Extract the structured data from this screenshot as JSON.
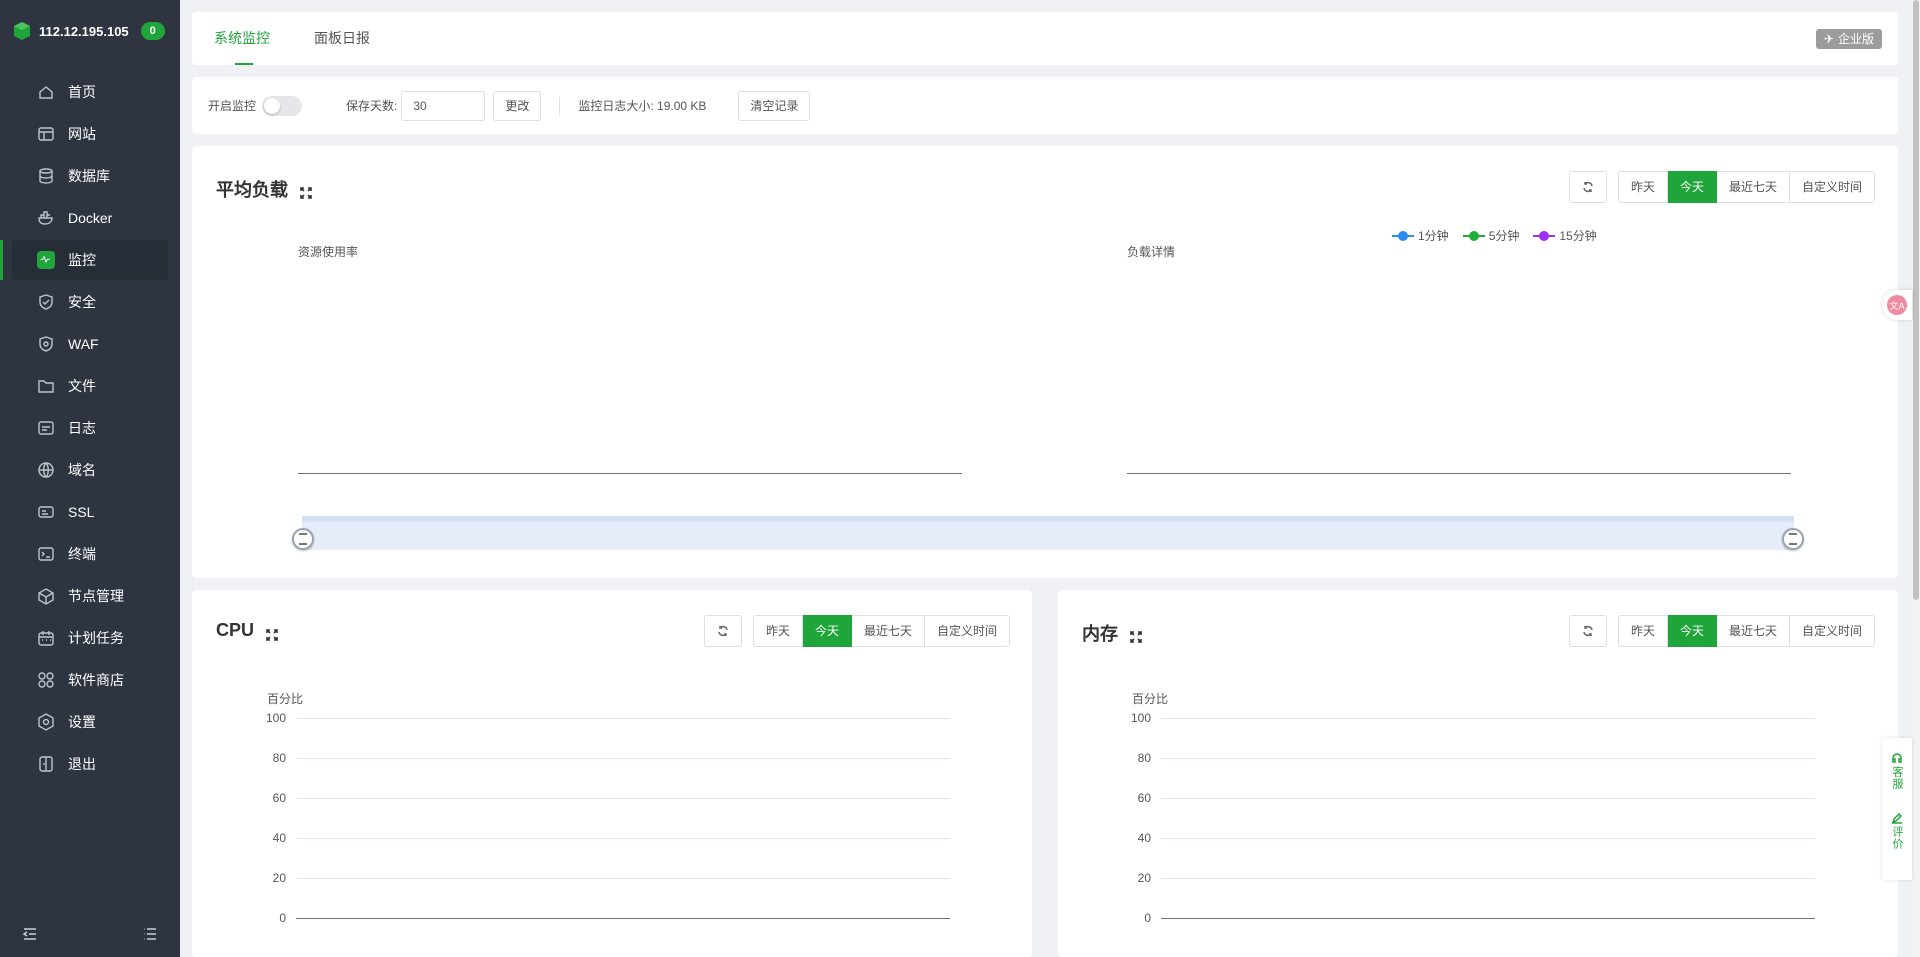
{
  "server": {
    "ip": "112.12.195.105",
    "badge": "0"
  },
  "sidebar": {
    "items": [
      {
        "label": "首页",
        "icon": "home-icon"
      },
      {
        "label": "网站",
        "icon": "website-icon"
      },
      {
        "label": "数据库",
        "icon": "database-icon"
      },
      {
        "label": "Docker",
        "icon": "docker-icon"
      },
      {
        "label": "监控",
        "icon": "monitor-icon",
        "active": true
      },
      {
        "label": "安全",
        "icon": "shield-icon"
      },
      {
        "label": "WAF",
        "icon": "waf-icon"
      },
      {
        "label": "文件",
        "icon": "folder-icon"
      },
      {
        "label": "日志",
        "icon": "log-icon"
      },
      {
        "label": "域名",
        "icon": "globe-icon"
      },
      {
        "label": "SSL",
        "icon": "ssl-icon"
      },
      {
        "label": "终端",
        "icon": "terminal-icon"
      },
      {
        "label": "节点管理",
        "icon": "node-icon"
      },
      {
        "label": "计划任务",
        "icon": "calendar-icon"
      },
      {
        "label": "软件商店",
        "icon": "apps-icon"
      },
      {
        "label": "设置",
        "icon": "settings-icon"
      },
      {
        "label": "退出",
        "icon": "logout-icon"
      }
    ]
  },
  "tabs": {
    "system_monitor": "系统监控",
    "panel_daily": "面板日报",
    "enterprise": "企业版"
  },
  "controls": {
    "enable_label": "开启监控",
    "enabled": false,
    "days_label": "保存天数:",
    "days_value": "30",
    "change_button": "更改",
    "log_size_label": "监控日志大小: 19.00 KB",
    "clear_button": "清空记录"
  },
  "ranges": {
    "yesterday": "昨天",
    "today": "今天",
    "last7": "最近七天",
    "custom": "自定义时间"
  },
  "load_panel": {
    "title": "平均负载",
    "left_chart_title": "资源使用率",
    "right_chart_title": "负载详情",
    "legend": [
      {
        "name": "1分钟",
        "color": "#2d8cf0"
      },
      {
        "name": "5分钟",
        "color": "#20b03a"
      },
      {
        "name": "15分钟",
        "color": "#9b30f0"
      }
    ]
  },
  "cpu_panel": {
    "title": "CPU",
    "ylabel": "百分比"
  },
  "mem_panel": {
    "title": "内存",
    "ylabel": "百分比"
  },
  "chart_data": [
    {
      "type": "line",
      "title": "资源使用率",
      "series": []
    },
    {
      "type": "line",
      "title": "负载详情",
      "series": [
        {
          "name": "1分钟",
          "values": []
        },
        {
          "name": "5分钟",
          "values": []
        },
        {
          "name": "15分钟",
          "values": []
        }
      ]
    },
    {
      "type": "line",
      "ylabel": "百分比",
      "ylim": [
        0,
        100
      ],
      "yticks": [
        100,
        80,
        60,
        40,
        20,
        0
      ],
      "series": []
    },
    {
      "type": "line",
      "ylabel": "百分比",
      "ylim": [
        0,
        100
      ],
      "yticks": [
        100,
        80,
        60,
        40,
        20,
        0
      ],
      "series": []
    }
  ],
  "float": {
    "service": "客服",
    "review": "评价"
  }
}
